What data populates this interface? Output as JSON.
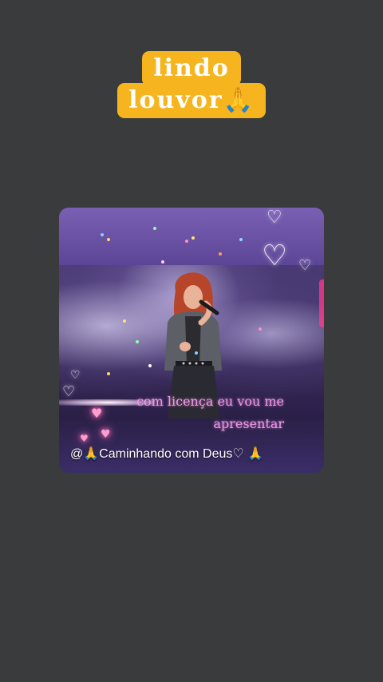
{
  "title": {
    "line1": "lindo",
    "line2": "louvor🙏",
    "background_color": "#f6b51e",
    "text_color": "#ffffff"
  },
  "video": {
    "lyric_line1": "com licença eu vou me",
    "lyric_line2": "apresentar",
    "lyric_color": "#e99be8",
    "credit": "@🙏Caminhando com Deus♡ 🙏"
  },
  "icons": {
    "heart_bubble": "heart-bubble-icon",
    "praying_hands": "praying-hands-icon"
  },
  "page": {
    "background_color": "#3a3b3c"
  }
}
